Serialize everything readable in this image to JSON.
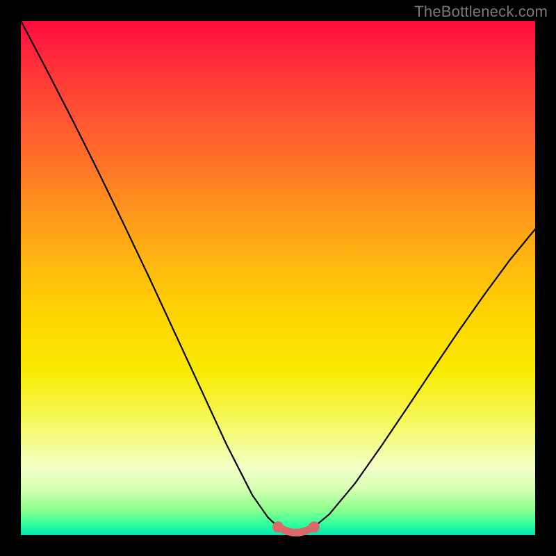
{
  "watermark": "TheBottleneck.com",
  "colors": {
    "curve_stroke": "#000000",
    "flat_stroke": "#d96a6a",
    "gradient_top": "#ff0b3e",
    "gradient_bottom": "#00e6b2"
  },
  "chart_data": {
    "type": "line",
    "title": "",
    "xlabel": "",
    "ylabel": "",
    "xlim": [
      0,
      100
    ],
    "ylim": [
      0,
      100
    ],
    "series": [
      {
        "name": "mismatch-curve",
        "x": [
          0,
          5,
          10,
          15,
          20,
          25,
          30,
          35,
          40,
          45,
          48,
          50,
          52,
          55,
          57,
          60,
          65,
          70,
          75,
          80,
          85,
          90,
          95,
          100
        ],
        "y": [
          100,
          90.5,
          80.8,
          70.8,
          60.5,
          50.0,
          39.2,
          28.4,
          17.6,
          7.8,
          3.5,
          1.6,
          0.5,
          0.5,
          1.6,
          4.1,
          10.1,
          17.2,
          24.6,
          32.1,
          39.5,
          46.6,
          53.4,
          59.5
        ]
      },
      {
        "name": "optimal-flat",
        "x": [
          50,
          51,
          52,
          53,
          54,
          55,
          56,
          57
        ],
        "y": [
          1.6,
          1.1,
          0.7,
          0.5,
          0.5,
          0.7,
          1.1,
          1.6
        ]
      }
    ]
  }
}
